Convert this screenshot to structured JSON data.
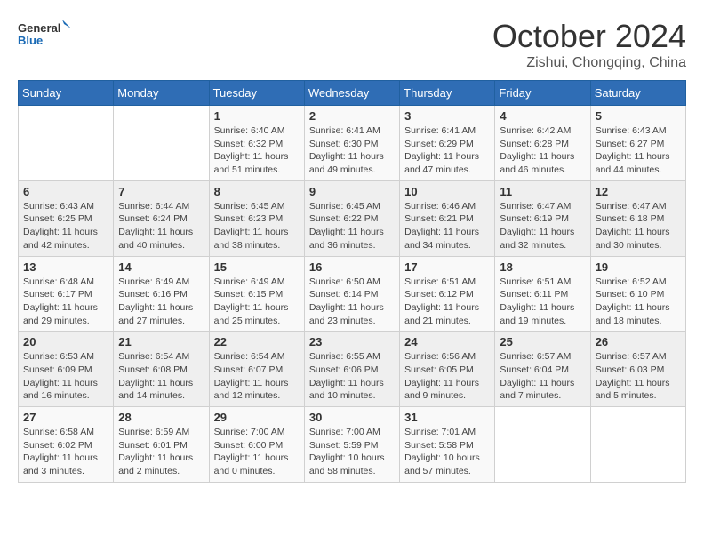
{
  "header": {
    "logo_general": "General",
    "logo_blue": "Blue",
    "month_title": "October 2024",
    "subtitle": "Zishui, Chongqing, China"
  },
  "weekdays": [
    "Sunday",
    "Monday",
    "Tuesday",
    "Wednesday",
    "Thursday",
    "Friday",
    "Saturday"
  ],
  "weeks": [
    [
      {
        "day": "",
        "sunrise": "",
        "sunset": "",
        "daylight": ""
      },
      {
        "day": "",
        "sunrise": "",
        "sunset": "",
        "daylight": ""
      },
      {
        "day": "1",
        "sunrise": "Sunrise: 6:40 AM",
        "sunset": "Sunset: 6:32 PM",
        "daylight": "Daylight: 11 hours and 51 minutes."
      },
      {
        "day": "2",
        "sunrise": "Sunrise: 6:41 AM",
        "sunset": "Sunset: 6:30 PM",
        "daylight": "Daylight: 11 hours and 49 minutes."
      },
      {
        "day": "3",
        "sunrise": "Sunrise: 6:41 AM",
        "sunset": "Sunset: 6:29 PM",
        "daylight": "Daylight: 11 hours and 47 minutes."
      },
      {
        "day": "4",
        "sunrise": "Sunrise: 6:42 AM",
        "sunset": "Sunset: 6:28 PM",
        "daylight": "Daylight: 11 hours and 46 minutes."
      },
      {
        "day": "5",
        "sunrise": "Sunrise: 6:43 AM",
        "sunset": "Sunset: 6:27 PM",
        "daylight": "Daylight: 11 hours and 44 minutes."
      }
    ],
    [
      {
        "day": "6",
        "sunrise": "Sunrise: 6:43 AM",
        "sunset": "Sunset: 6:25 PM",
        "daylight": "Daylight: 11 hours and 42 minutes."
      },
      {
        "day": "7",
        "sunrise": "Sunrise: 6:44 AM",
        "sunset": "Sunset: 6:24 PM",
        "daylight": "Daylight: 11 hours and 40 minutes."
      },
      {
        "day": "8",
        "sunrise": "Sunrise: 6:45 AM",
        "sunset": "Sunset: 6:23 PM",
        "daylight": "Daylight: 11 hours and 38 minutes."
      },
      {
        "day": "9",
        "sunrise": "Sunrise: 6:45 AM",
        "sunset": "Sunset: 6:22 PM",
        "daylight": "Daylight: 11 hours and 36 minutes."
      },
      {
        "day": "10",
        "sunrise": "Sunrise: 6:46 AM",
        "sunset": "Sunset: 6:21 PM",
        "daylight": "Daylight: 11 hours and 34 minutes."
      },
      {
        "day": "11",
        "sunrise": "Sunrise: 6:47 AM",
        "sunset": "Sunset: 6:19 PM",
        "daylight": "Daylight: 11 hours and 32 minutes."
      },
      {
        "day": "12",
        "sunrise": "Sunrise: 6:47 AM",
        "sunset": "Sunset: 6:18 PM",
        "daylight": "Daylight: 11 hours and 30 minutes."
      }
    ],
    [
      {
        "day": "13",
        "sunrise": "Sunrise: 6:48 AM",
        "sunset": "Sunset: 6:17 PM",
        "daylight": "Daylight: 11 hours and 29 minutes."
      },
      {
        "day": "14",
        "sunrise": "Sunrise: 6:49 AM",
        "sunset": "Sunset: 6:16 PM",
        "daylight": "Daylight: 11 hours and 27 minutes."
      },
      {
        "day": "15",
        "sunrise": "Sunrise: 6:49 AM",
        "sunset": "Sunset: 6:15 PM",
        "daylight": "Daylight: 11 hours and 25 minutes."
      },
      {
        "day": "16",
        "sunrise": "Sunrise: 6:50 AM",
        "sunset": "Sunset: 6:14 PM",
        "daylight": "Daylight: 11 hours and 23 minutes."
      },
      {
        "day": "17",
        "sunrise": "Sunrise: 6:51 AM",
        "sunset": "Sunset: 6:12 PM",
        "daylight": "Daylight: 11 hours and 21 minutes."
      },
      {
        "day": "18",
        "sunrise": "Sunrise: 6:51 AM",
        "sunset": "Sunset: 6:11 PM",
        "daylight": "Daylight: 11 hours and 19 minutes."
      },
      {
        "day": "19",
        "sunrise": "Sunrise: 6:52 AM",
        "sunset": "Sunset: 6:10 PM",
        "daylight": "Daylight: 11 hours and 18 minutes."
      }
    ],
    [
      {
        "day": "20",
        "sunrise": "Sunrise: 6:53 AM",
        "sunset": "Sunset: 6:09 PM",
        "daylight": "Daylight: 11 hours and 16 minutes."
      },
      {
        "day": "21",
        "sunrise": "Sunrise: 6:54 AM",
        "sunset": "Sunset: 6:08 PM",
        "daylight": "Daylight: 11 hours and 14 minutes."
      },
      {
        "day": "22",
        "sunrise": "Sunrise: 6:54 AM",
        "sunset": "Sunset: 6:07 PM",
        "daylight": "Daylight: 11 hours and 12 minutes."
      },
      {
        "day": "23",
        "sunrise": "Sunrise: 6:55 AM",
        "sunset": "Sunset: 6:06 PM",
        "daylight": "Daylight: 11 hours and 10 minutes."
      },
      {
        "day": "24",
        "sunrise": "Sunrise: 6:56 AM",
        "sunset": "Sunset: 6:05 PM",
        "daylight": "Daylight: 11 hours and 9 minutes."
      },
      {
        "day": "25",
        "sunrise": "Sunrise: 6:57 AM",
        "sunset": "Sunset: 6:04 PM",
        "daylight": "Daylight: 11 hours and 7 minutes."
      },
      {
        "day": "26",
        "sunrise": "Sunrise: 6:57 AM",
        "sunset": "Sunset: 6:03 PM",
        "daylight": "Daylight: 11 hours and 5 minutes."
      }
    ],
    [
      {
        "day": "27",
        "sunrise": "Sunrise: 6:58 AM",
        "sunset": "Sunset: 6:02 PM",
        "daylight": "Daylight: 11 hours and 3 minutes."
      },
      {
        "day": "28",
        "sunrise": "Sunrise: 6:59 AM",
        "sunset": "Sunset: 6:01 PM",
        "daylight": "Daylight: 11 hours and 2 minutes."
      },
      {
        "day": "29",
        "sunrise": "Sunrise: 7:00 AM",
        "sunset": "Sunset: 6:00 PM",
        "daylight": "Daylight: 11 hours and 0 minutes."
      },
      {
        "day": "30",
        "sunrise": "Sunrise: 7:00 AM",
        "sunset": "Sunset: 5:59 PM",
        "daylight": "Daylight: 10 hours and 58 minutes."
      },
      {
        "day": "31",
        "sunrise": "Sunrise: 7:01 AM",
        "sunset": "Sunset: 5:58 PM",
        "daylight": "Daylight: 10 hours and 57 minutes."
      },
      {
        "day": "",
        "sunrise": "",
        "sunset": "",
        "daylight": ""
      },
      {
        "day": "",
        "sunrise": "",
        "sunset": "",
        "daylight": ""
      }
    ]
  ]
}
